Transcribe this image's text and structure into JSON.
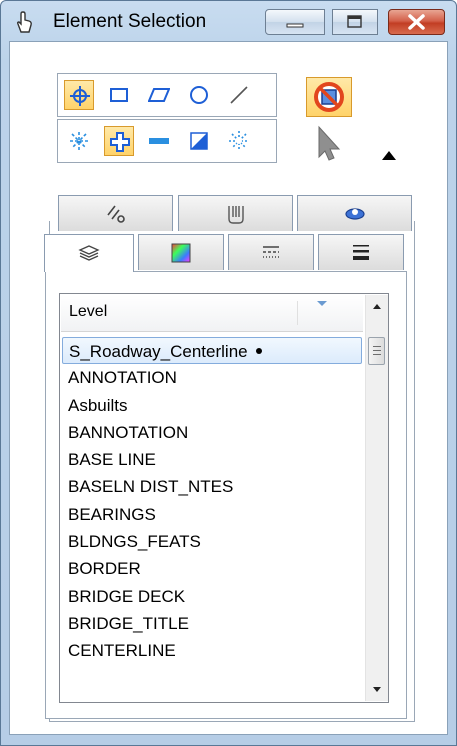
{
  "window": {
    "title": "Element Selection",
    "icons": {
      "app": "hand-pointer-icon",
      "minimize": "minimize-icon",
      "maximize": "maximize-icon",
      "close": "close-icon"
    }
  },
  "tools": {
    "row1": [
      "element-mode-icon",
      "block-mode-icon",
      "shape-mode-icon",
      "circle-mode-icon",
      "line-mode-icon"
    ],
    "row2": [
      "new-selection-icon",
      "add-selection-icon",
      "subtract-selection-icon",
      "invert-selection-icon",
      "clear-selection-icon"
    ],
    "side": [
      "selection-filter-icon",
      "select-arrow-icon"
    ],
    "colors": {
      "selected_bg": "#ffd36a",
      "accent_blue": "#1e5fd6"
    }
  },
  "tabs_back": [
    "line-style-tab-icon",
    "weight-tab-icon",
    "class-tab-icon"
  ],
  "tabs_front": [
    "levels-tab-icon",
    "color-tab-icon",
    "style-tab-icon",
    "weight-lines-tab-icon"
  ],
  "list": {
    "header": "Level",
    "items": [
      "S_Roadway_Centerline",
      "ANNOTATION",
      "Asbuilts",
      "BANNOTATION",
      "BASE LINE",
      "BASELN DIST_NTES",
      "BEARINGS",
      "BLDNGS_FEATS",
      "BORDER",
      "BRIDGE DECK",
      "BRIDGE_TITLE",
      "CENTERLINE"
    ],
    "selected_index": 0
  }
}
